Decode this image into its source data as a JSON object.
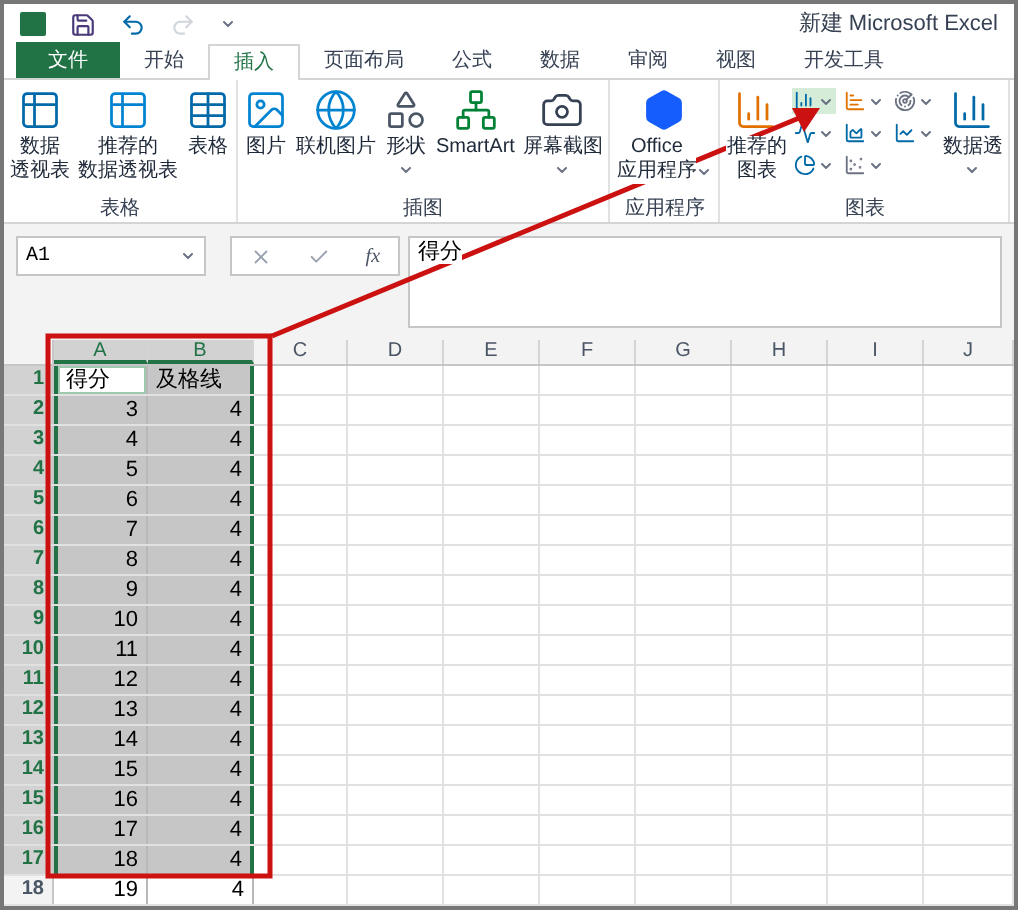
{
  "window": {
    "title": "新建 Microsoft Excel"
  },
  "tabs": [
    {
      "label": "文件",
      "kind": "file",
      "selected": false
    },
    {
      "label": "开始",
      "kind": "tab",
      "selected": false
    },
    {
      "label": "插入",
      "kind": "tab",
      "selected": true
    },
    {
      "label": "页面布局",
      "kind": "tab",
      "selected": false
    },
    {
      "label": "公式",
      "kind": "tab",
      "selected": false
    },
    {
      "label": "数据",
      "kind": "tab",
      "selected": false
    },
    {
      "label": "审阅",
      "kind": "tab",
      "selected": false
    },
    {
      "label": "视图",
      "kind": "tab",
      "selected": false
    },
    {
      "label": "开发工具",
      "kind": "tab",
      "selected": false
    }
  ],
  "ribbon": [
    {
      "label": "表格",
      "items": [
        {
          "kind": "pivot",
          "lines": [
            "数据",
            "透视表"
          ]
        },
        {
          "kind": "recommended-pivot",
          "lines": [
            "推荐的",
            "数据透视表"
          ]
        },
        {
          "kind": "table",
          "lines": [
            "表格"
          ]
        }
      ]
    },
    {
      "label": "插图",
      "items": [
        {
          "kind": "picture",
          "lines": [
            "图片"
          ]
        },
        {
          "kind": "online-picture",
          "lines": [
            "联机图片"
          ]
        },
        {
          "kind": "shapes",
          "lines": [
            "形状"
          ],
          "dropdown": true
        },
        {
          "kind": "smartart",
          "lines": [
            "SmartArt"
          ]
        },
        {
          "kind": "screenshot",
          "lines": [
            "屏幕截图"
          ],
          "dropdown": true
        }
      ]
    },
    {
      "label": "应用程序",
      "items": [
        {
          "kind": "office",
          "lines": [
            "Office",
            "应用程序"
          ],
          "dropdown": true
        }
      ]
    },
    {
      "label": "图表",
      "items": [
        {
          "kind": "recommended-chart",
          "lines": [
            "推荐的",
            "图表"
          ]
        },
        {
          "kind": "chart-grid"
        },
        {
          "kind": "pivot-chart",
          "lines": [
            "数据透"
          ],
          "dropdown": true
        }
      ]
    }
  ],
  "formula_bar": {
    "name_box": "A1",
    "function_label": "fx",
    "formula": "得分"
  },
  "sheet": {
    "columns": [
      {
        "label": "A",
        "selected": true
      },
      {
        "label": "B",
        "selected": true
      },
      {
        "label": "C",
        "selected": false
      },
      {
        "label": "D",
        "selected": false
      },
      {
        "label": "E",
        "selected": false
      },
      {
        "label": "F",
        "selected": false
      },
      {
        "label": "G",
        "selected": false
      },
      {
        "label": "H",
        "selected": false
      },
      {
        "label": "I",
        "selected": false
      },
      {
        "label": "J",
        "selected": false
      }
    ],
    "rows": [
      {
        "number": "1",
        "kind": "header",
        "selected": true,
        "cells": [
          {
            "text": "得分",
            "selected": true,
            "active": true
          },
          {
            "text": "及格线",
            "selected": true,
            "active": false
          }
        ]
      },
      {
        "number": "2",
        "kind": "data",
        "selected": true,
        "cells": [
          {
            "text": "3",
            "selected": true,
            "active": false
          },
          {
            "text": "4",
            "selected": true,
            "active": false
          }
        ]
      },
      {
        "number": "3",
        "kind": "data",
        "selected": true,
        "cells": [
          {
            "text": "4",
            "selected": true,
            "active": false
          },
          {
            "text": "4",
            "selected": true,
            "active": false
          }
        ]
      },
      {
        "number": "4",
        "kind": "data",
        "selected": true,
        "cells": [
          {
            "text": "5",
            "selected": true,
            "active": false
          },
          {
            "text": "4",
            "selected": true,
            "active": false
          }
        ]
      },
      {
        "number": "5",
        "kind": "data",
        "selected": true,
        "cells": [
          {
            "text": "6",
            "selected": true,
            "active": false
          },
          {
            "text": "4",
            "selected": true,
            "active": false
          }
        ]
      },
      {
        "number": "6",
        "kind": "data",
        "selected": true,
        "cells": [
          {
            "text": "7",
            "selected": true,
            "active": false
          },
          {
            "text": "4",
            "selected": true,
            "active": false
          }
        ]
      },
      {
        "number": "7",
        "kind": "data",
        "selected": true,
        "cells": [
          {
            "text": "8",
            "selected": true,
            "active": false
          },
          {
            "text": "4",
            "selected": true,
            "active": false
          }
        ]
      },
      {
        "number": "8",
        "kind": "data",
        "selected": true,
        "cells": [
          {
            "text": "9",
            "selected": true,
            "active": false
          },
          {
            "text": "4",
            "selected": true,
            "active": false
          }
        ]
      },
      {
        "number": "9",
        "kind": "data",
        "selected": true,
        "cells": [
          {
            "text": "10",
            "selected": true,
            "active": false
          },
          {
            "text": "4",
            "selected": true,
            "active": false
          }
        ]
      },
      {
        "number": "10",
        "kind": "data",
        "selected": true,
        "cells": [
          {
            "text": "11",
            "selected": true,
            "active": false
          },
          {
            "text": "4",
            "selected": true,
            "active": false
          }
        ]
      },
      {
        "number": "11",
        "kind": "data",
        "selected": true,
        "cells": [
          {
            "text": "12",
            "selected": true,
            "active": false
          },
          {
            "text": "4",
            "selected": true,
            "active": false
          }
        ]
      },
      {
        "number": "12",
        "kind": "data",
        "selected": true,
        "cells": [
          {
            "text": "13",
            "selected": true,
            "active": false
          },
          {
            "text": "4",
            "selected": true,
            "active": false
          }
        ]
      },
      {
        "number": "13",
        "kind": "data",
        "selected": true,
        "cells": [
          {
            "text": "14",
            "selected": true,
            "active": false
          },
          {
            "text": "4",
            "selected": true,
            "active": false
          }
        ]
      },
      {
        "number": "14",
        "kind": "data",
        "selected": true,
        "cells": [
          {
            "text": "15",
            "selected": true,
            "active": false
          },
          {
            "text": "4",
            "selected": true,
            "active": false
          }
        ]
      },
      {
        "number": "15",
        "kind": "data",
        "selected": true,
        "cells": [
          {
            "text": "16",
            "selected": true,
            "active": false
          },
          {
            "text": "4",
            "selected": true,
            "active": false
          }
        ]
      },
      {
        "number": "16",
        "kind": "data",
        "selected": true,
        "cells": [
          {
            "text": "17",
            "selected": true,
            "active": false
          },
          {
            "text": "4",
            "selected": true,
            "active": false
          }
        ]
      },
      {
        "number": "17",
        "kind": "data",
        "selected": true,
        "cells": [
          {
            "text": "18",
            "selected": true,
            "active": false
          },
          {
            "text": "4",
            "selected": true,
            "active": false
          }
        ]
      },
      {
        "number": "18",
        "kind": "data",
        "selected": false,
        "cells": [
          {
            "text": "19",
            "selected": false,
            "active": false
          },
          {
            "text": "4",
            "selected": false,
            "active": false
          }
        ]
      }
    ]
  }
}
